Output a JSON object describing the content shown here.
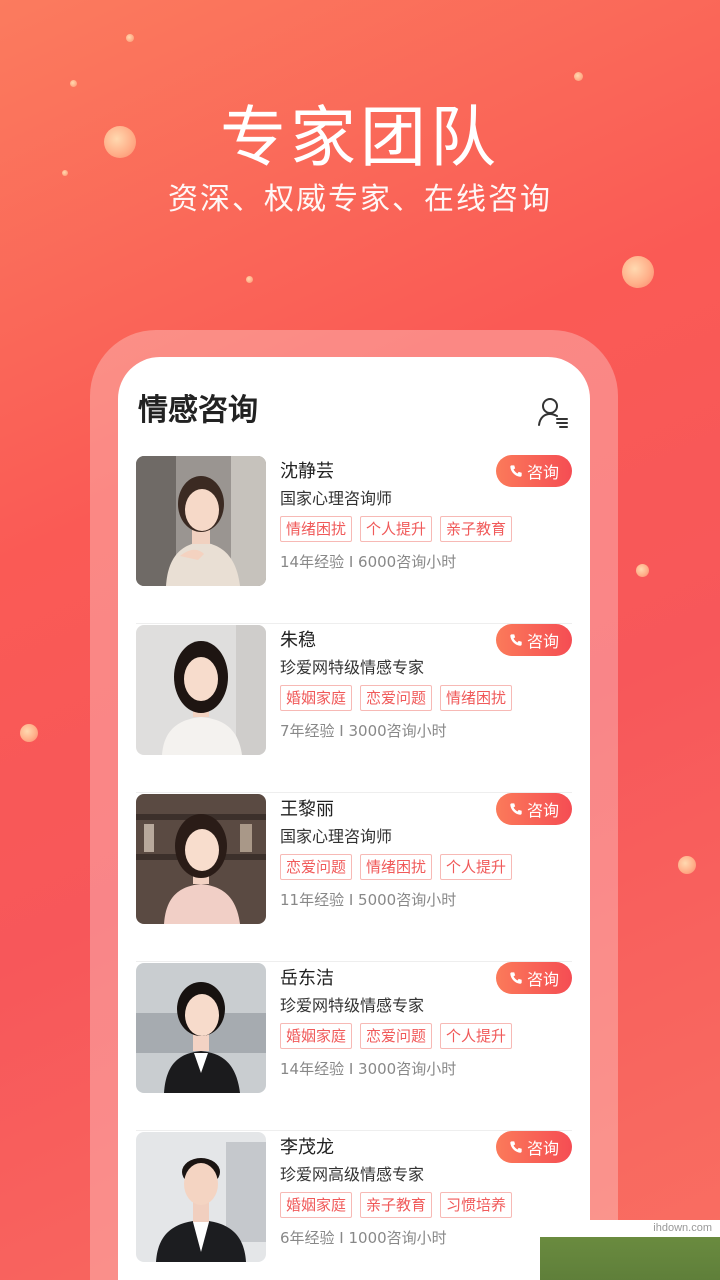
{
  "hero": {
    "title": "专家团队",
    "subtitle": "资深、权威专家、在线咨询"
  },
  "screen": {
    "title": "情感咨询",
    "header_icon": "user-list-icon"
  },
  "consult_label": "咨询",
  "experts": [
    {
      "name": "沈静芸",
      "title": "国家心理咨询师",
      "tags": [
        "情绪困扰",
        "个人提升",
        "亲子教育"
      ],
      "stats": "14年经验 I 6000咨询小时",
      "consult": "咨询"
    },
    {
      "name": "朱稳",
      "title": "珍爱网特级情感专家",
      "tags": [
        "婚姻家庭",
        "恋爱问题",
        "情绪困扰"
      ],
      "stats": "7年经验 I 3000咨询小时",
      "consult": "咨询"
    },
    {
      "name": "王黎丽",
      "title": "国家心理咨询师",
      "tags": [
        "恋爱问题",
        "情绪困扰",
        "个人提升"
      ],
      "stats": "11年经验 I 5000咨询小时",
      "consult": "咨询"
    },
    {
      "name": "岳东洁",
      "title": "珍爱网特级情感专家",
      "tags": [
        "婚姻家庭",
        "恋爱问题",
        "个人提升"
      ],
      "stats": "14年经验 I 3000咨询小时",
      "consult": "咨询"
    },
    {
      "name": "李茂龙",
      "title": "珍爱网高级情感专家",
      "tags": [
        "婚姻家庭",
        "亲子教育",
        "习惯培养"
      ],
      "stats": "6年经验 I 1000咨询小时",
      "consult": "咨询"
    }
  ],
  "watermark": "ihdown.com",
  "colors": {
    "accent": "#f54d53",
    "tag_text": "#f05a5a",
    "tag_border": "#f7b9b5"
  }
}
